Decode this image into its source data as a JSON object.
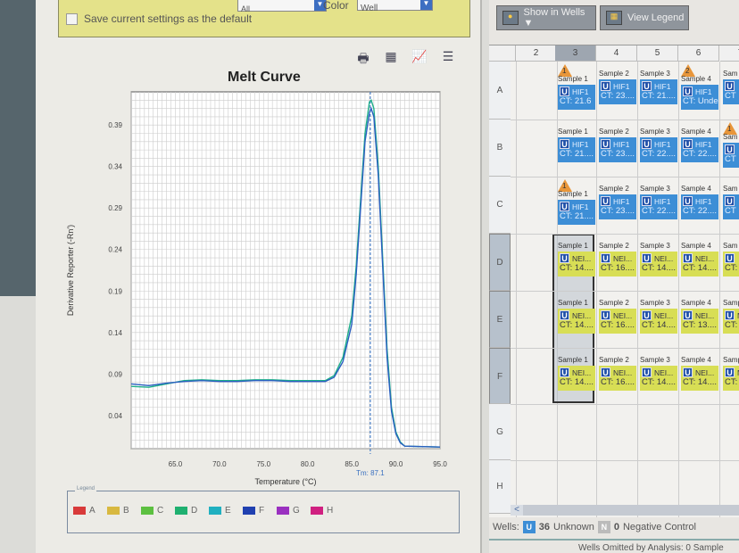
{
  "settings": {
    "save_default_label": "Save current settings as the default",
    "target_value": "All",
    "color_label": "Color",
    "color_value": "Well"
  },
  "toolbar": {
    "icons": [
      "printer-icon",
      "save-image-icon",
      "plot-settings-icon",
      "legend-list-icon"
    ]
  },
  "chart_data": {
    "type": "line",
    "title": "Melt Curve",
    "xlabel": "Temperature (°C)",
    "ylabel": "Derivative Reporter (-Rn')",
    "xlim": [
      60,
      95
    ],
    "ylim": [
      0,
      0.43
    ],
    "grid": true,
    "xticks": [
      "65.0",
      "70.0",
      "75.0",
      "80.0",
      "85.0",
      "90.0",
      "95.0"
    ],
    "yticks": [
      "0.04",
      "0.09",
      "0.14",
      "0.19",
      "0.24",
      "0.29",
      "0.34",
      "0.39"
    ],
    "tm_label": "Tm: 87.1",
    "tm": 87.1,
    "series": [
      {
        "name": "D",
        "color": "#1fb08a",
        "x": [
          60,
          62,
          64,
          66,
          68,
          70,
          72,
          74,
          76,
          78,
          80,
          82,
          83,
          84,
          85,
          85.5,
          86,
          86.5,
          87,
          87.2,
          87.5,
          88,
          88.5,
          89,
          89.5,
          90,
          90.5,
          91,
          95
        ],
        "y": [
          0.075,
          0.074,
          0.078,
          0.082,
          0.083,
          0.082,
          0.082,
          0.083,
          0.083,
          0.082,
          0.082,
          0.082,
          0.088,
          0.11,
          0.16,
          0.22,
          0.3,
          0.38,
          0.418,
          0.42,
          0.41,
          0.34,
          0.23,
          0.12,
          0.05,
          0.02,
          0.008,
          0.003,
          0.002
        ]
      },
      {
        "name": "F",
        "color": "#2a5fc0",
        "x": [
          60,
          62,
          64,
          66,
          68,
          70,
          72,
          74,
          76,
          78,
          80,
          82,
          83,
          84,
          85,
          85.5,
          86,
          86.5,
          87,
          87.2,
          87.5,
          88,
          88.5,
          89,
          89.5,
          90,
          90.5,
          91,
          95
        ],
        "y": [
          0.078,
          0.076,
          0.079,
          0.081,
          0.082,
          0.081,
          0.081,
          0.082,
          0.082,
          0.081,
          0.081,
          0.081,
          0.086,
          0.105,
          0.15,
          0.21,
          0.29,
          0.37,
          0.405,
          0.41,
          0.4,
          0.33,
          0.22,
          0.11,
          0.045,
          0.018,
          0.007,
          0.003,
          0.002
        ]
      }
    ]
  },
  "legend": {
    "title": "Legend",
    "items": [
      {
        "label": "A",
        "color": "#d83a3a"
      },
      {
        "label": "B",
        "color": "#d8b840"
      },
      {
        "label": "C",
        "color": "#5cc040"
      },
      {
        "label": "D",
        "color": "#1fb070"
      },
      {
        "label": "E",
        "color": "#20b0c0"
      },
      {
        "label": "F",
        "color": "#2040b0"
      },
      {
        "label": "G",
        "color": "#9a30c0"
      },
      {
        "label": "H",
        "color": "#d02080"
      }
    ]
  },
  "plate": {
    "show_in_wells_label": "Show in Wells ▼",
    "view_legend_label": "View Legend",
    "columns": [
      "2",
      "3",
      "4",
      "5",
      "6",
      "7"
    ],
    "selected_column": "3",
    "rows": [
      "A",
      "B",
      "C",
      "D",
      "E",
      "F",
      "G",
      "H"
    ],
    "wells": {
      "A": [
        null,
        {
          "flag": "1",
          "sample": "Sample 1",
          "target": "HIF1",
          "ct": "CT: 21.6",
          "type": "blue"
        },
        {
          "sample": "Sample 2",
          "target": "HIF1",
          "ct": "CT: 23....",
          "type": "blue"
        },
        {
          "sample": "Sample 3",
          "target": "HIF1",
          "ct": "CT: 21....",
          "type": "blue"
        },
        {
          "flag": "2",
          "sample": "Sample 4",
          "target": "HIF1",
          "ct": "CT: Unde",
          "type": "blue"
        },
        {
          "sample": "Sam",
          "target": "",
          "ct": "CT",
          "type": "blue"
        }
      ],
      "B": [
        null,
        {
          "sample": "Sample 1",
          "target": "HIF1",
          "ct": "CT: 21....",
          "type": "blue"
        },
        {
          "sample": "Sample 2",
          "target": "HIF1",
          "ct": "CT: 23....",
          "type": "blue"
        },
        {
          "sample": "Sample 3",
          "target": "HIF1",
          "ct": "CT: 22....",
          "type": "blue"
        },
        {
          "sample": "Sample 4",
          "target": "HIF1",
          "ct": "CT: 22....",
          "type": "blue"
        },
        {
          "flag": "1",
          "sample": "Sam",
          "target": "",
          "ct": "CT",
          "type": "blue"
        }
      ],
      "C": [
        null,
        {
          "flag": "1",
          "sample": "Sample 1",
          "target": "HIF1",
          "ct": "CT: 21....",
          "type": "blue"
        },
        {
          "sample": "Sample 2",
          "target": "HIF1",
          "ct": "CT: 23....",
          "type": "blue"
        },
        {
          "sample": "Sample 3",
          "target": "HIF1",
          "ct": "CT: 22....",
          "type": "blue"
        },
        {
          "sample": "Sample 4",
          "target": "HIF1",
          "ct": "CT: 22....",
          "type": "blue"
        },
        {
          "sample": "Sam",
          "target": "",
          "ct": "CT",
          "type": "blue"
        }
      ],
      "D": [
        null,
        {
          "sample": "Sample 1",
          "target": "NEI...",
          "ct": "CT: 14....",
          "type": "yellow"
        },
        {
          "sample": "Sample 2",
          "target": "NEI...",
          "ct": "CT: 16....",
          "type": "yellow"
        },
        {
          "sample": "Sample 3",
          "target": "NEI...",
          "ct": "CT: 14....",
          "type": "yellow"
        },
        {
          "sample": "Sample 4",
          "target": "NEI...",
          "ct": "CT: 14....",
          "type": "yellow"
        },
        {
          "sample": "Sam",
          "target": "",
          "ct": "CT: 1",
          "type": "yellow"
        }
      ],
      "E": [
        null,
        {
          "sample": "Sample 1",
          "target": "NEI...",
          "ct": "CT: 14....",
          "type": "yellow"
        },
        {
          "sample": "Sample 2",
          "target": "NEI...",
          "ct": "CT: 16....",
          "type": "yellow"
        },
        {
          "sample": "Sample 3",
          "target": "NEI...",
          "ct": "CT: 14....",
          "type": "yellow"
        },
        {
          "sample": "Sample 4",
          "target": "NEI...",
          "ct": "CT: 13....",
          "type": "yellow"
        },
        {
          "sample": "Samp",
          "target": "N",
          "ct": "CT: 1",
          "type": "yellow"
        }
      ],
      "F": [
        null,
        {
          "sample": "Sample 1",
          "target": "NEI...",
          "ct": "CT: 14....",
          "type": "yellow"
        },
        {
          "sample": "Sample 2",
          "target": "NEI...",
          "ct": "CT: 16....",
          "type": "yellow"
        },
        {
          "sample": "Sample 3",
          "target": "NEI...",
          "ct": "CT: 14....",
          "type": "yellow"
        },
        {
          "sample": "Sample 4",
          "target": "NEI...",
          "ct": "CT: 14....",
          "type": "yellow"
        },
        {
          "sample": "Samp",
          "target": "N",
          "ct": "CT: 1",
          "type": "yellow"
        }
      ]
    },
    "wells_label": "Wells:",
    "unknown_count": "36",
    "unknown_label": "Unknown",
    "neg_count": "0",
    "neg_label": "Negative Control",
    "status_text": "Wells Omitted by Analysis: 0     Sample"
  }
}
